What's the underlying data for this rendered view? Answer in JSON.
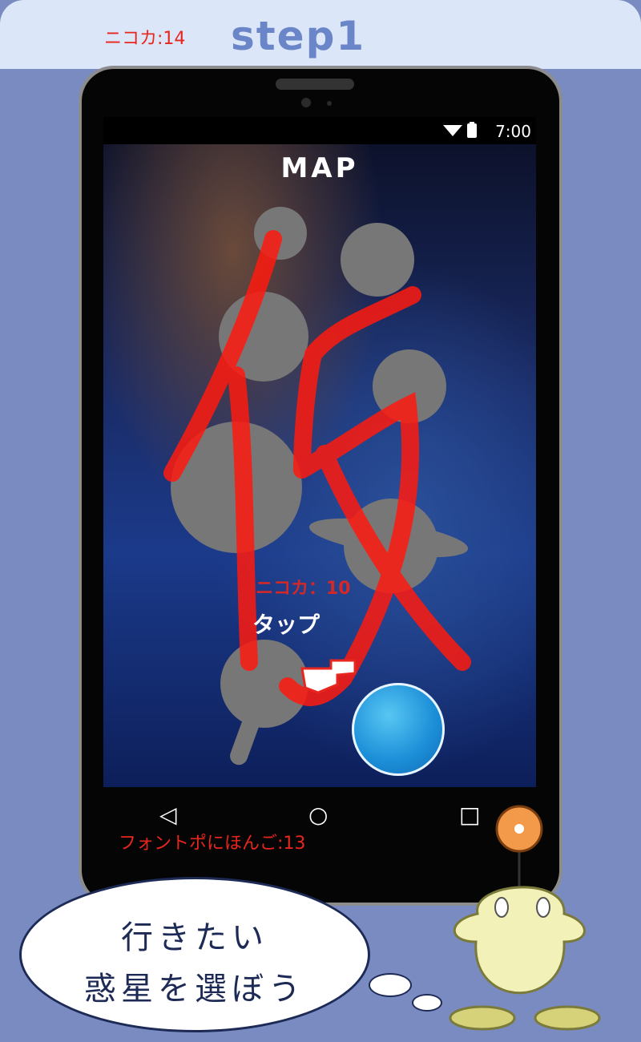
{
  "banner": {
    "note": "ニコカ:14",
    "title": "step1"
  },
  "status": {
    "time": "7:00",
    "icons": "▼ ▮"
  },
  "map": {
    "title": "MAP"
  },
  "screen": {
    "nika_label": "ニコカ：10",
    "tap_label": "タップ"
  },
  "nav": {
    "back": "◁",
    "home": "○",
    "recents": "□"
  },
  "font_note": "フォントポにほんご:13",
  "bubble": {
    "line1": "行きたい",
    "line2": "惑星を選ぼう"
  },
  "colors": {
    "accent_red": "#e8261e",
    "banner_bg": "#dbe6f9",
    "page_bg": "#7a8bc2",
    "title_blue": "#6b86c8"
  },
  "icons": [
    "wifi-icon",
    "battery-icon",
    "hand-pointer-icon",
    "back-icon",
    "home-icon",
    "recents-icon"
  ]
}
